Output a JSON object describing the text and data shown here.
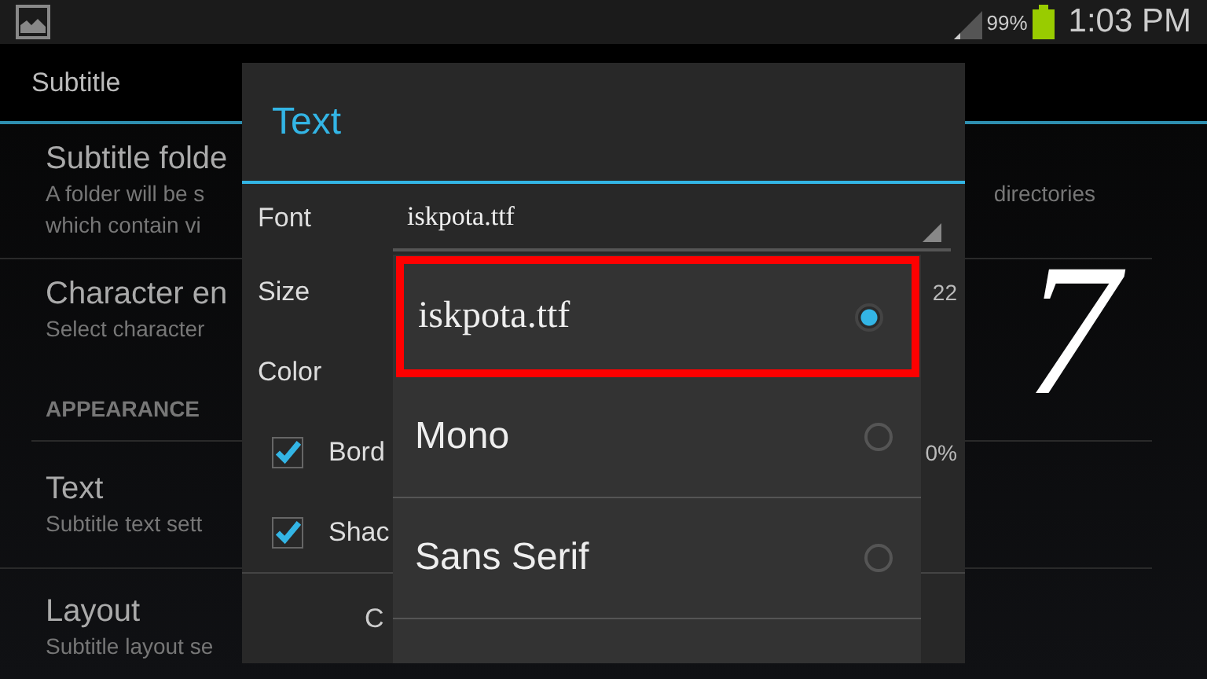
{
  "status_bar": {
    "battery": "99%",
    "time": "1:03 PM"
  },
  "action_bar": {
    "title": "Subtitle"
  },
  "settings": [
    {
      "kind": "item",
      "title": "Subtitle folde",
      "summary": [
        "A folder will be s",
        "which contain vi"
      ],
      "summary_tail": "directories"
    },
    {
      "kind": "item",
      "title": "Character en",
      "summary": [
        "Select character"
      ]
    },
    {
      "kind": "category",
      "title": "APPEARANCE"
    },
    {
      "kind": "item",
      "title": "Text",
      "summary": [
        "Subtitle text sett"
      ]
    },
    {
      "kind": "item",
      "title": "Layout",
      "summary": [
        "Subtitle layout se"
      ]
    }
  ],
  "dialog": {
    "title": "Text",
    "fields": [
      {
        "kind": "spinner",
        "label": "Font",
        "value": "iskpota.ttf"
      },
      {
        "kind": "value",
        "label": "Size",
        "value": "22"
      },
      {
        "kind": "plain",
        "label": "Color"
      },
      {
        "kind": "checkbox",
        "label": "Bord",
        "checked": true,
        "value": "0%"
      },
      {
        "kind": "checkbox",
        "label": "Shac",
        "checked": true
      }
    ],
    "buttons": [
      "C"
    ]
  },
  "dropdown": {
    "options": [
      {
        "label": "iskpota.ttf",
        "kind": "serif",
        "selected": true,
        "highlighted": true
      },
      {
        "label": "Mono",
        "kind": "sans",
        "selected": false,
        "highlighted": false
      },
      {
        "label": "Sans Serif",
        "kind": "sans",
        "selected": false,
        "highlighted": false
      }
    ]
  },
  "annotation": {
    "text": "7"
  }
}
